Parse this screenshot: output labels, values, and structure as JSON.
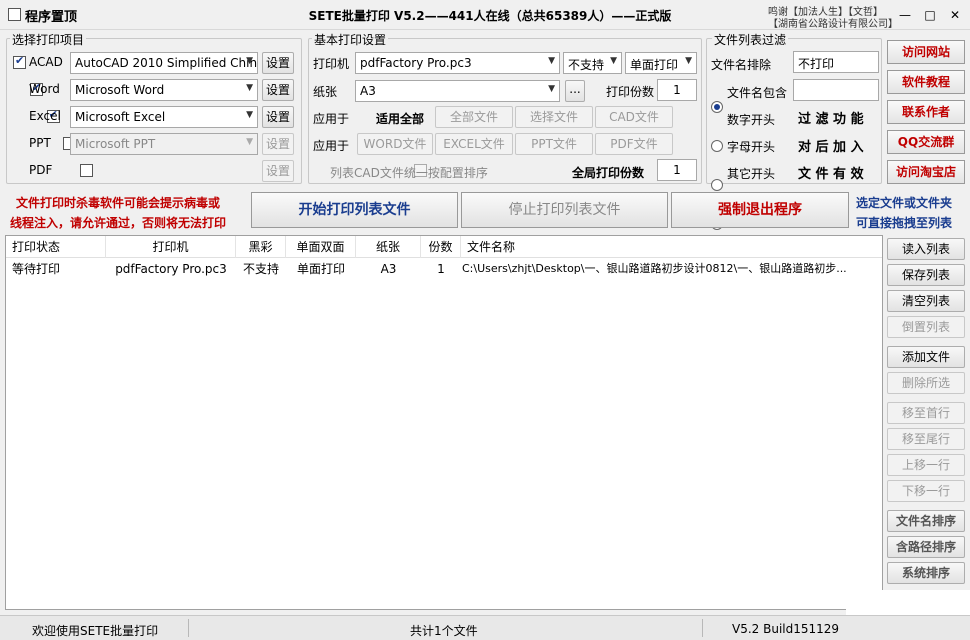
{
  "titlebar": {
    "pin_label": "程序置顶",
    "title": "SETE批量打印 V5.2——441人在线（总共65389人）——正式版",
    "credit_line1": "鸣谢【加法人生】【文哲】",
    "credit_line2": "【湖南省公路设计有限公司】",
    "min": "—",
    "max": "□",
    "close": "✕"
  },
  "print_items": {
    "title": "选择打印项目",
    "set_label": "设置",
    "rows": [
      {
        "label": "ACAD",
        "checked": true,
        "value": "AutoCAD 2010 Simplified Chin",
        "enabled": true
      },
      {
        "label": "Word",
        "checked": true,
        "value": "Microsoft Word",
        "enabled": true
      },
      {
        "label": "Excel",
        "checked": true,
        "value": "Microsoft Excel",
        "enabled": true
      },
      {
        "label": "PPT",
        "checked": false,
        "value": "Microsoft PPT",
        "enabled": false
      },
      {
        "label": "PDF",
        "checked": false,
        "value": "",
        "enabled": false
      }
    ]
  },
  "basic": {
    "title": "基本打印设置",
    "printer_label": "打印机",
    "printer_value": "pdfFactory Pro.pc3",
    "color_value": "不支持",
    "duplex_value": "单面打印",
    "paper_label": "纸张",
    "paper_value": "A3",
    "browse": "...",
    "copies_label": "打印份数",
    "copies_value": "1",
    "apply_label1": "应用于",
    "apply_all_label": "适用全部",
    "btn_all_files": "全部文件",
    "btn_selected_files": "选择文件",
    "btn_cad_files": "CAD文件",
    "apply_label2": "应用于",
    "btn_word_files": "WORD文件",
    "btn_excel_files": "EXCEL文件",
    "btn_ppt_files": "PPT文件",
    "btn_pdf_files": "PDF文件",
    "cad_sort_label": "列表CAD文件统一按配置排序",
    "global_copies_label": "全局打印份数",
    "global_copies_value": "1"
  },
  "filter": {
    "title": "文件列表过滤",
    "exclude_label": "文件名排除",
    "exclude_value": "不打印",
    "contains_label": "文件名包含",
    "digit_label": "数字开头",
    "letter_label": "字母开头",
    "other_label": "其它开头",
    "desc_1": "过 滤 功 能",
    "desc_2": "对 后 加 入",
    "desc_3": "文 件 有 效"
  },
  "links": {
    "visit_site": "访问网站",
    "tutorial": "软件教程",
    "contact": "联系作者",
    "qq_group": "QQ交流群",
    "taobao": "访问淘宝店"
  },
  "actions": {
    "warning_line1": "文件打印时杀毒软件可能会提示病毒或",
    "warning_line2": "线程注入，请允许通过，否则将无法打印",
    "start": "开始打印列表文件",
    "stop": "停止打印列表文件",
    "force_exit": "强制退出程序",
    "drag_hint_line1": "选定文件或文件夹",
    "drag_hint_line2": "可直接拖拽至列表"
  },
  "table": {
    "headers": [
      "打印状态",
      "打印机",
      "黑彩",
      "单面双面",
      "纸张",
      "份数",
      "文件名称"
    ],
    "rows": [
      [
        "等待打印",
        "pdfFactory Pro.pc3",
        "不支持",
        "单面打印",
        "A3",
        "1",
        "C:\\Users\\zhjt\\Desktop\\一、银山路道路初步设计0812\\一、银山路道路初步..."
      ]
    ]
  },
  "side": {
    "read_list": "读入列表",
    "save_list": "保存列表",
    "clear_list": "清空列表",
    "reverse_list": "倒置列表",
    "add_file": "添加文件",
    "delete_selected": "删除所选",
    "move_first": "移至首行",
    "move_last": "移至尾行",
    "move_up": "上移一行",
    "move_down": "下移一行",
    "sort_name": "文件名排序",
    "sort_path": "含路径排序",
    "sort_system": "系统排序"
  },
  "status": {
    "welcome": "欢迎使用SETE批量打印",
    "count": "共计1个文件",
    "version": "V5.2 Build151129"
  },
  "colors": {
    "warning_red": "#c00000",
    "hint_blue": "#1a3d8f",
    "link_red": "#c00000"
  }
}
